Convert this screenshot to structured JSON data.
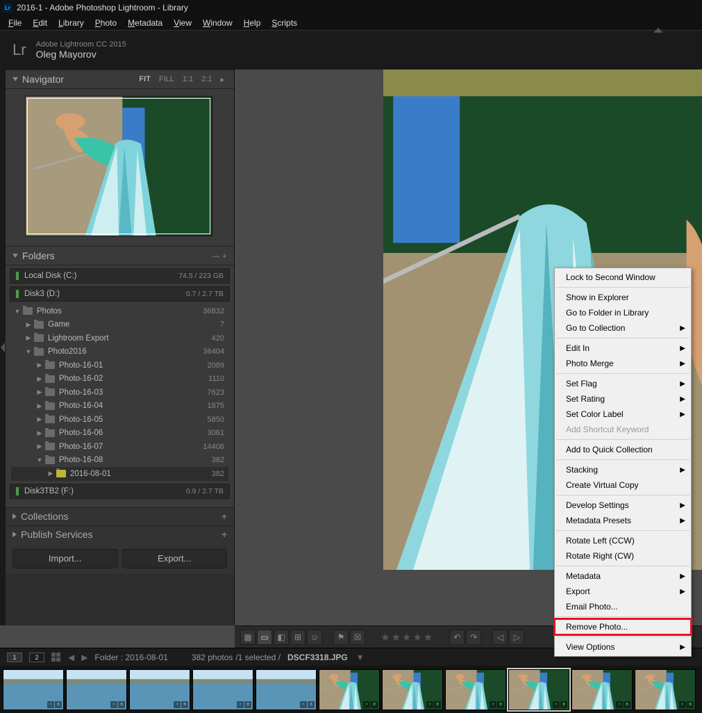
{
  "window_title": "2016-1 - Adobe Photoshop Lightroom - Library",
  "menu": [
    "File",
    "Edit",
    "Library",
    "Photo",
    "Metadata",
    "View",
    "Window",
    "Help",
    "Scripts"
  ],
  "identity": {
    "product": "Adobe Lightroom CC 2015",
    "user": "Oleg Mayorov",
    "logo": "Lr"
  },
  "navigator": {
    "title": "Navigator",
    "zoom": [
      "FIT",
      "FILL",
      "1:1",
      "2:1"
    ]
  },
  "folders": {
    "title": "Folders",
    "drives": [
      {
        "name": "Local Disk (C:)",
        "size": "74.5 / 223 GB"
      },
      {
        "name": "Disk3 (D:)",
        "size": "0.7 / 2.7 TB"
      }
    ],
    "tree": [
      {
        "d": 0,
        "caret": "down",
        "nm": "Photos",
        "ct": "36832"
      },
      {
        "d": 1,
        "caret": "right",
        "nm": "Game",
        "ct": "7"
      },
      {
        "d": 1,
        "caret": "right",
        "nm": "Lightroom Export",
        "ct": "420"
      },
      {
        "d": 1,
        "caret": "down",
        "nm": "Photo2016",
        "ct": "36404"
      },
      {
        "d": 2,
        "caret": "right",
        "nm": "Photo-16-01",
        "ct": "2089"
      },
      {
        "d": 2,
        "caret": "right",
        "nm": "Photo-16-02",
        "ct": "1110"
      },
      {
        "d": 2,
        "caret": "right",
        "nm": "Photo-16-03",
        "ct": "7623"
      },
      {
        "d": 2,
        "caret": "right",
        "nm": "Photo-16-04",
        "ct": "1875"
      },
      {
        "d": 2,
        "caret": "right",
        "nm": "Photo-16-05",
        "ct": "5850"
      },
      {
        "d": 2,
        "caret": "right",
        "nm": "Photo-16-06",
        "ct": "3061"
      },
      {
        "d": 2,
        "caret": "right",
        "nm": "Photo-16-07",
        "ct": "14406"
      },
      {
        "d": 2,
        "caret": "down",
        "nm": "Photo-16-08",
        "ct": "382"
      },
      {
        "d": 3,
        "caret": "right",
        "nm": "2016-08-01",
        "ct": "382",
        "sel": true
      }
    ],
    "drives2": [
      {
        "name": "Disk3TB2 (F:)",
        "size": "0.9 / 2.7 TB"
      }
    ]
  },
  "collections": {
    "title": "Collections"
  },
  "publish": {
    "title": "Publish Services"
  },
  "buttons": {
    "import": "Import...",
    "export": "Export..."
  },
  "filmstrip_header": {
    "mon1": "1",
    "mon2": "2",
    "label": "Folder :",
    "folder": "2016-08-01",
    "count": "382 photos",
    "selected": "/1 selected /",
    "filename": "DSCF3318.JPG"
  },
  "context_menu": [
    {
      "t": "item",
      "label": "Lock to Second Window"
    },
    {
      "t": "sep"
    },
    {
      "t": "item",
      "label": "Show in Explorer"
    },
    {
      "t": "item",
      "label": "Go to Folder in Library"
    },
    {
      "t": "item",
      "label": "Go to Collection",
      "sub": true
    },
    {
      "t": "sep"
    },
    {
      "t": "item",
      "label": "Edit In",
      "sub": true
    },
    {
      "t": "item",
      "label": "Photo Merge",
      "sub": true
    },
    {
      "t": "sep"
    },
    {
      "t": "item",
      "label": "Set Flag",
      "sub": true
    },
    {
      "t": "item",
      "label": "Set Rating",
      "sub": true
    },
    {
      "t": "item",
      "label": "Set Color Label",
      "sub": true
    },
    {
      "t": "item",
      "label": "Add Shortcut Keyword",
      "dis": true
    },
    {
      "t": "sep"
    },
    {
      "t": "item",
      "label": "Add to Quick Collection"
    },
    {
      "t": "sep"
    },
    {
      "t": "item",
      "label": "Stacking",
      "sub": true
    },
    {
      "t": "item",
      "label": "Create Virtual Copy"
    },
    {
      "t": "sep"
    },
    {
      "t": "item",
      "label": "Develop Settings",
      "sub": true
    },
    {
      "t": "item",
      "label": "Metadata Presets",
      "sub": true
    },
    {
      "t": "sep"
    },
    {
      "t": "item",
      "label": "Rotate Left (CCW)"
    },
    {
      "t": "item",
      "label": "Rotate Right (CW)"
    },
    {
      "t": "sep"
    },
    {
      "t": "item",
      "label": "Metadata",
      "sub": true
    },
    {
      "t": "item",
      "label": "Export",
      "sub": true
    },
    {
      "t": "item",
      "label": "Email Photo..."
    },
    {
      "t": "sep"
    },
    {
      "t": "item",
      "label": "Remove Photo...",
      "hl": true
    },
    {
      "t": "sep"
    },
    {
      "t": "item",
      "label": "View Options",
      "sub": true
    }
  ],
  "thumbs": 11,
  "thumb_selected": 8
}
